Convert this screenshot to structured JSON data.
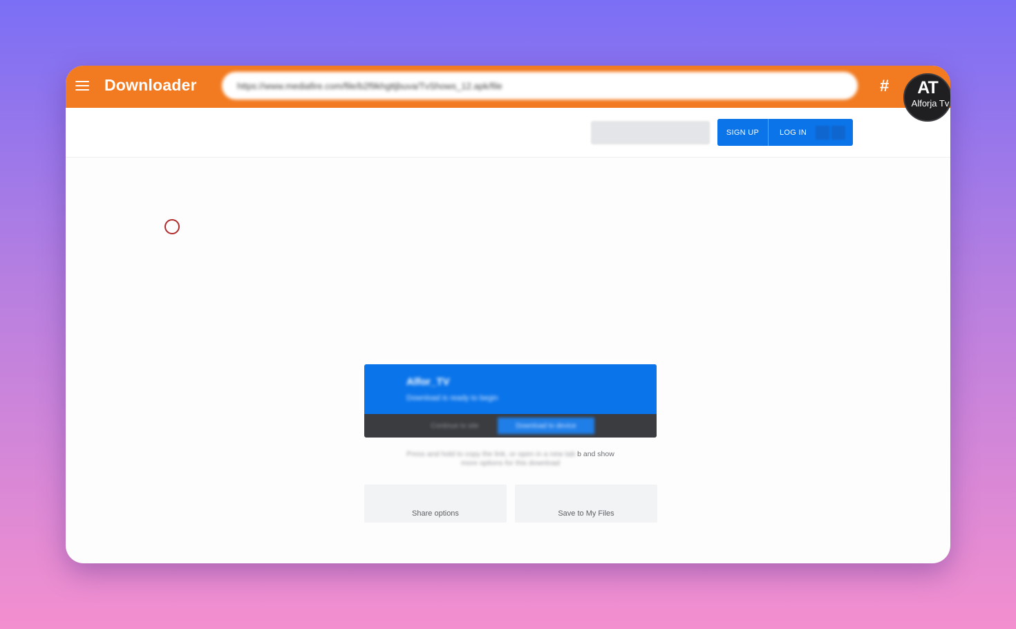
{
  "app": {
    "brand": "Downloader"
  },
  "toolbar": {
    "url_value": "https://www.mediafire.com/file/b2f9khgttjbuva/TvShows_12.apk/file",
    "hash_label": "#"
  },
  "avatar": {
    "monogram": "AT",
    "name": "Alforja Tv"
  },
  "auth": {
    "signup_label": "SIGN UP",
    "login_label": "LOG IN"
  },
  "card": {
    "title": "Alfor_TV",
    "subtitle": "Download is ready to begin",
    "dark_button": "Continue to site",
    "blue_button": "Download to device"
  },
  "description": {
    "blurred_text": "Press and hold to copy the link, or open in a new tab",
    "visible_text": "b and show",
    "second_line": "more options for this download"
  },
  "tiles": {
    "share_label": "Share options",
    "save_label": "Save to My Files"
  },
  "colors": {
    "appbar": "#f27b21",
    "primary_blue": "#0a74e8",
    "cursor_ring": "#b12a2a"
  }
}
